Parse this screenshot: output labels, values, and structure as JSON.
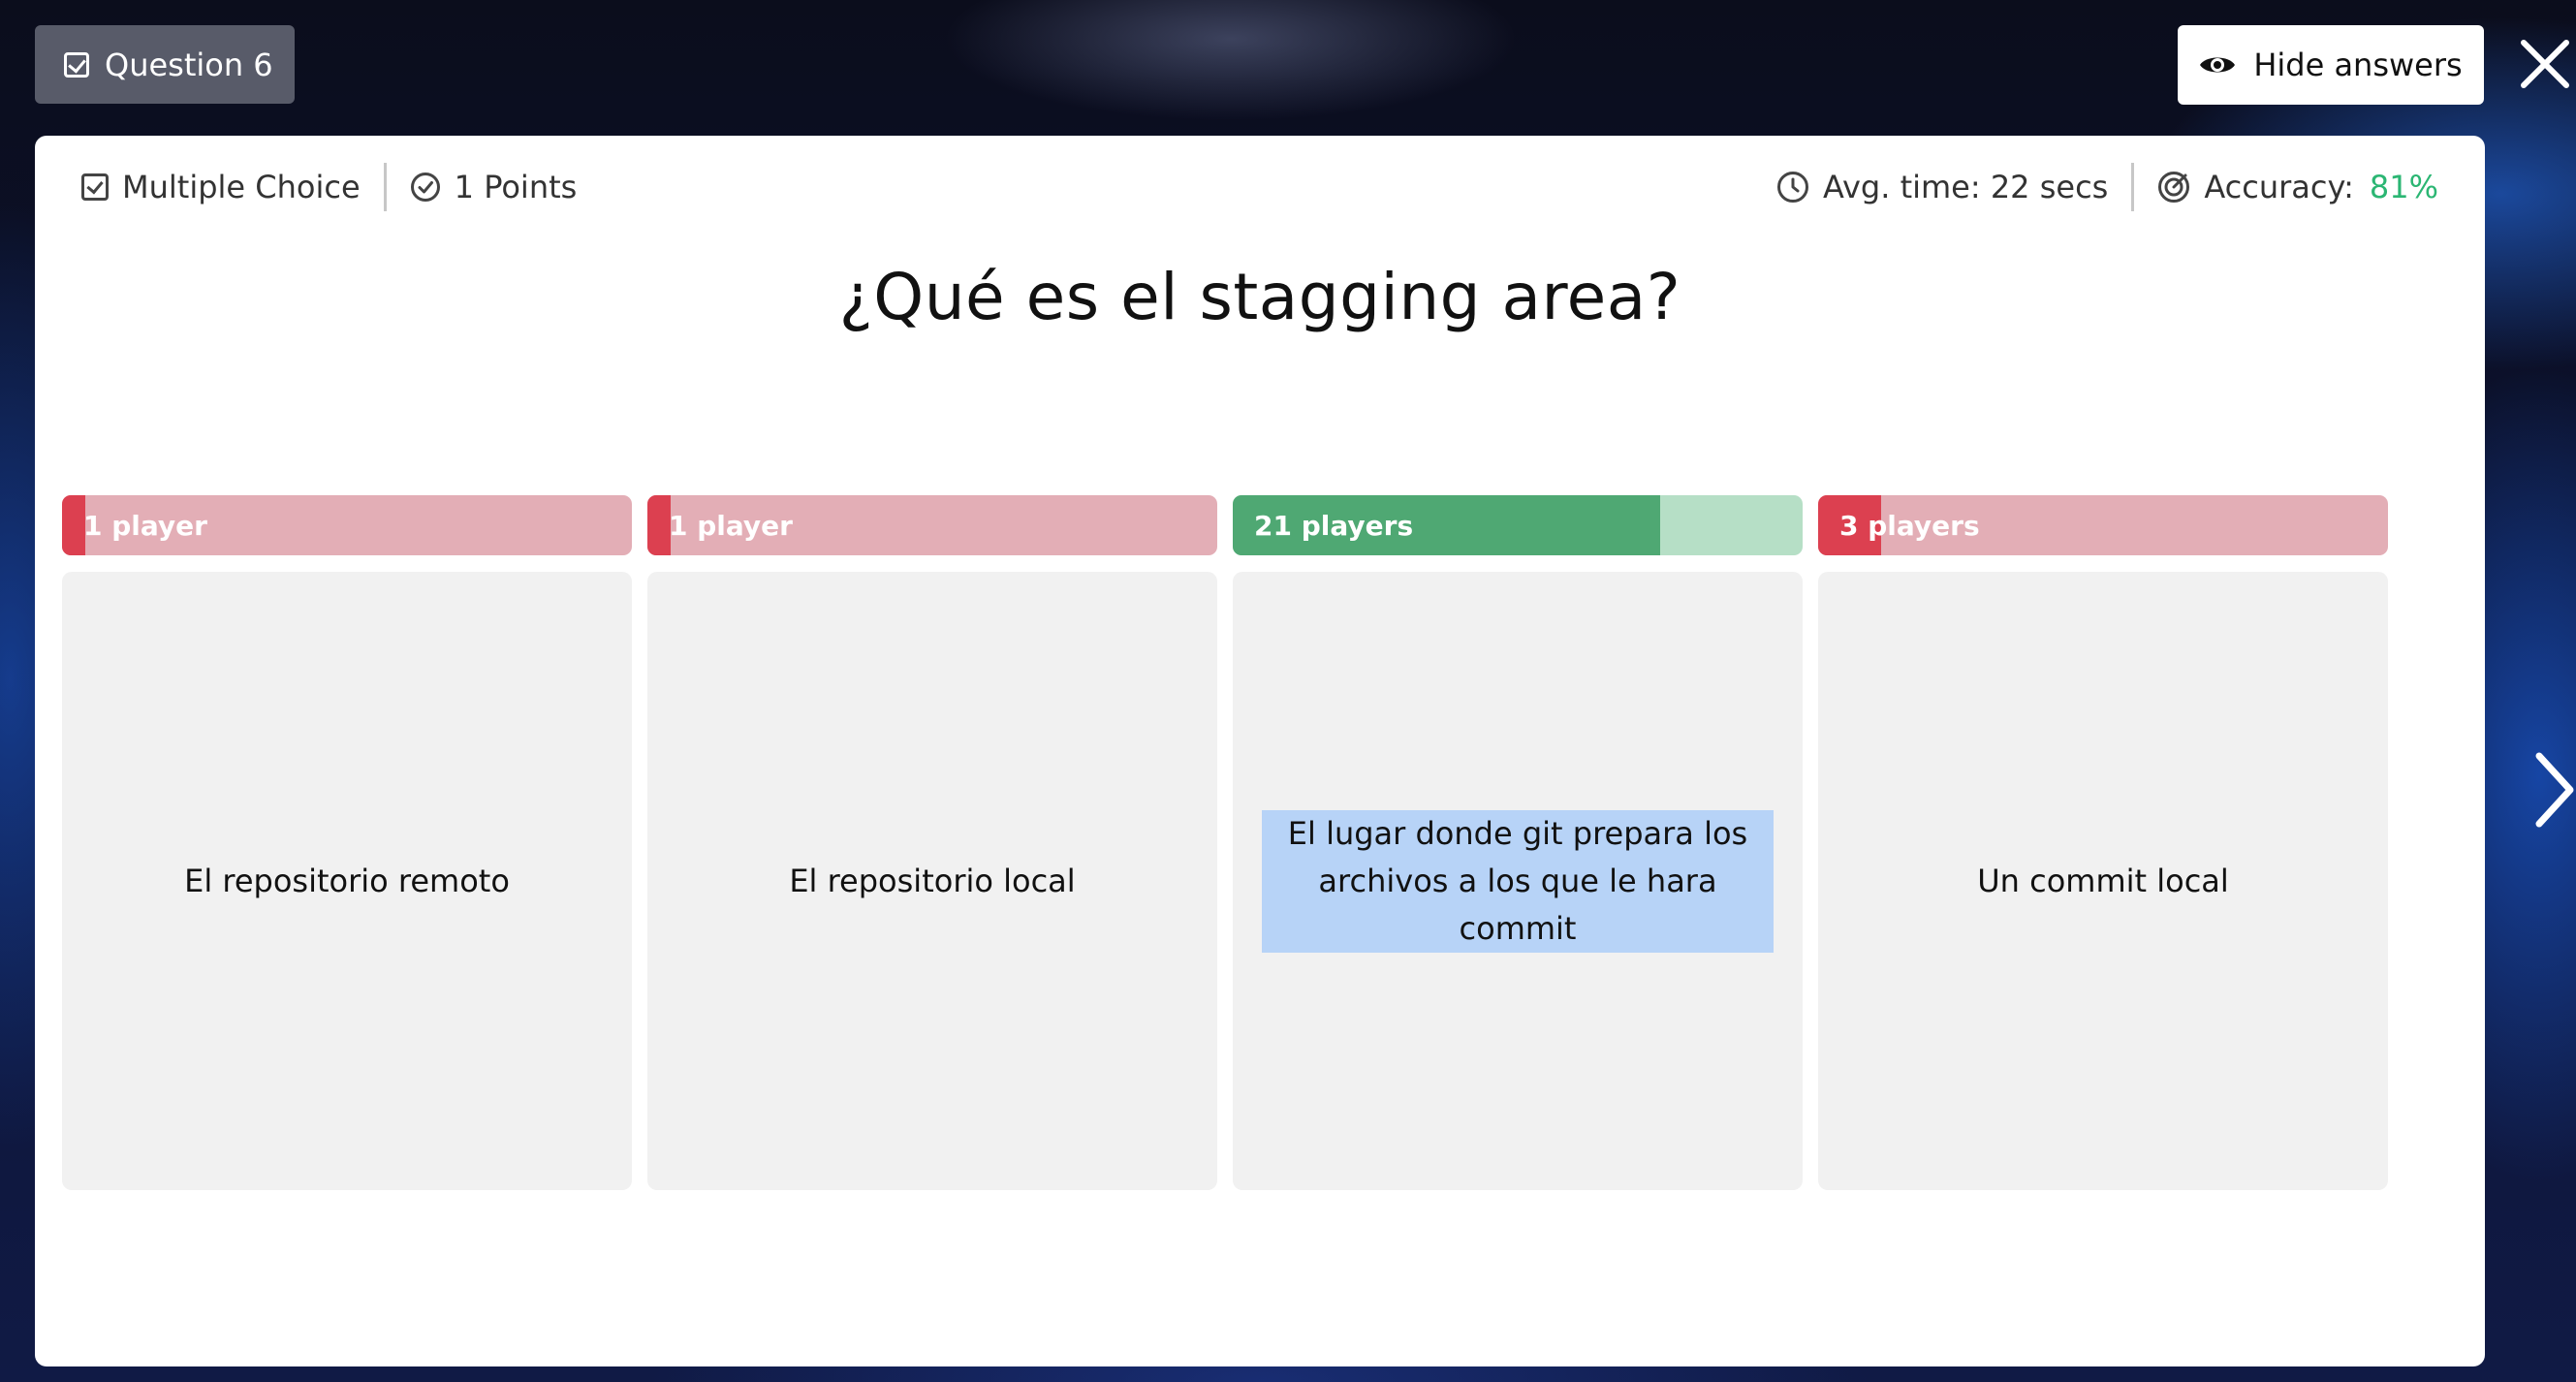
{
  "header": {
    "question_chip": "Question 6",
    "hide_answers_label": "Hide answers"
  },
  "meta": {
    "type": "Multiple Choice",
    "points": "1 Points",
    "avg_time": "Avg. time: 22 secs",
    "accuracy_label": "Accuracy:",
    "accuracy_value": "81%"
  },
  "question": "¿Qué es el stagging area?",
  "answers": [
    {
      "text": "El repositorio remoto",
      "players_label": "1 player",
      "players": 1,
      "share": 0.04,
      "correct": false
    },
    {
      "text": "El repositorio local",
      "players_label": "1 player",
      "players": 1,
      "share": 0.04,
      "correct": false
    },
    {
      "text": "El lugar donde git prepara los archivos a los que le hara commit",
      "players_label": "21 players",
      "players": 21,
      "share": 0.75,
      "correct": true
    },
    {
      "text": "Un commit local",
      "players_label": "3 players",
      "players": 3,
      "share": 0.11,
      "correct": false
    }
  ],
  "colors": {
    "correct": "#4fa873",
    "correct_track": "#b6dfc6",
    "wrong": "#dc4050",
    "wrong_track": "#e3aeb6",
    "accuracy": "#2bb673"
  }
}
